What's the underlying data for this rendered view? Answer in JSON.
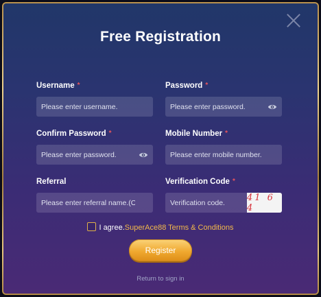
{
  "modal": {
    "title": "Free Registration",
    "close_icon": "close-icon"
  },
  "fields": {
    "username": {
      "label": "Username",
      "required": "*",
      "placeholder": "Please enter username."
    },
    "password": {
      "label": "Password",
      "required": "*",
      "placeholder": "Please enter password.",
      "icon": "eye-icon"
    },
    "confirm_password": {
      "label": "Confirm Password",
      "required": "*",
      "placeholder": "Please enter password.",
      "icon": "eye-icon"
    },
    "mobile": {
      "label": "Mobile Number",
      "required": "*",
      "placeholder": "Please enter mobile number."
    },
    "referral": {
      "label": "Referral",
      "placeholder": "Please enter referral name.(Opt.)"
    },
    "verification": {
      "label": "Verification Code",
      "required": "*",
      "placeholder": "Verification code.",
      "captcha": "41 6 4"
    }
  },
  "agreement": {
    "prefix": "I agree.",
    "link": "SuperAce88 Terms & Conditions"
  },
  "register_label": "Register",
  "signin_label": "Return to sign in",
  "colors": {
    "accent": "#f0a930",
    "required": "#e8555d",
    "brand_link": "#f2b94a"
  }
}
